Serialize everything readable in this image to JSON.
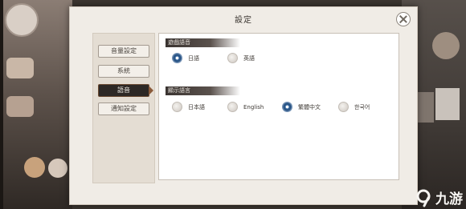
{
  "dialog": {
    "title": "設定"
  },
  "sidebar": {
    "items": [
      {
        "label": "音量設定",
        "active": false
      },
      {
        "label": "系統",
        "active": false
      },
      {
        "label": "語音",
        "active": true
      },
      {
        "label": "通知設定",
        "active": false
      }
    ]
  },
  "voice_language": {
    "label": "遊戲語音",
    "options": [
      {
        "label": "日語",
        "selected": true
      },
      {
        "label": "英語",
        "selected": false
      }
    ]
  },
  "display_language": {
    "label": "顯示語言",
    "options": [
      {
        "label": "日本語",
        "selected": false
      },
      {
        "label": "English",
        "selected": false
      },
      {
        "label": "繁體中文",
        "selected": true
      },
      {
        "label": "한국어",
        "selected": false
      }
    ]
  },
  "watermark": {
    "text": "九游",
    "logo_icon": "9-logo-icon"
  },
  "colors": {
    "accent": "#2d2825",
    "radio_selected": "#1f4a7a",
    "panel": "#f0ece6"
  }
}
